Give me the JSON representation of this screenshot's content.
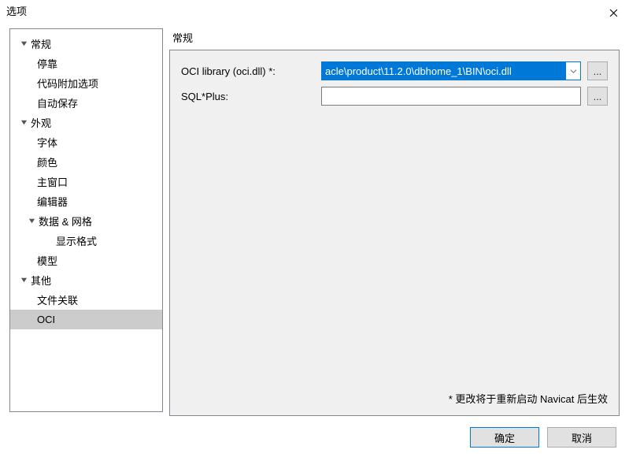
{
  "window": {
    "title": "选项"
  },
  "sidebar": {
    "nodes": [
      {
        "label": "常规",
        "level": 0,
        "chevron": true
      },
      {
        "label": "停靠",
        "level": 1
      },
      {
        "label": "代码附加选项",
        "level": 1
      },
      {
        "label": "自动保存",
        "level": 1
      },
      {
        "label": "外观",
        "level": 0,
        "chevron": true
      },
      {
        "label": "字体",
        "level": 1
      },
      {
        "label": "颜色",
        "level": 1
      },
      {
        "label": "主窗口",
        "level": 1
      },
      {
        "label": "编辑器",
        "level": 1
      },
      {
        "label": "数据 & 网格",
        "level": 1,
        "chevron": true
      },
      {
        "label": "显示格式",
        "level": 2
      },
      {
        "label": "模型",
        "level": 1
      },
      {
        "label": "其他",
        "level": 0,
        "chevron": true
      },
      {
        "label": "文件关联",
        "level": 1
      },
      {
        "label": "OCI",
        "level": 1,
        "selected": true
      }
    ]
  },
  "main": {
    "section_title": "常规",
    "rows": {
      "oci": {
        "label": "OCI library (oci.dll) *:",
        "value": "acle\\product\\11.2.0\\dbhome_1\\BIN\\oci.dll",
        "browse": "..."
      },
      "sqlplus": {
        "label": "SQL*Plus:",
        "value": "",
        "browse": "..."
      }
    },
    "note": "* 更改将于重新启动 Navicat 后生效"
  },
  "footer": {
    "ok": "确定",
    "cancel": "取消"
  }
}
